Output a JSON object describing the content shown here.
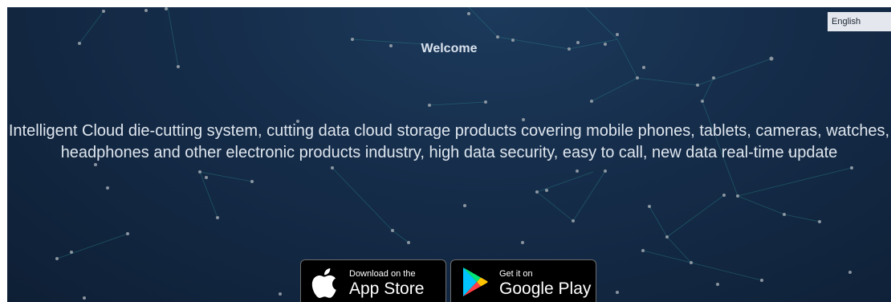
{
  "hero": {
    "welcome": "Welcome",
    "description": "Intelligent Cloud die-cutting system, cutting data cloud storage products covering mobile phones, tablets, cameras, watches, headphones and other electronic products industry, high data security, easy to call, new data real-time update"
  },
  "language_select": {
    "value": "English"
  },
  "badges": {
    "appstore": {
      "small": "Download on the",
      "big": "App Store"
    },
    "googleplay": {
      "small": "Get it on",
      "big": "Google Play"
    }
  },
  "colors": {
    "background_dark": "#0e1f35",
    "background_light": "#1c3a5c",
    "network_line": "#2a8a8c",
    "network_node": "#a0a8b0"
  }
}
